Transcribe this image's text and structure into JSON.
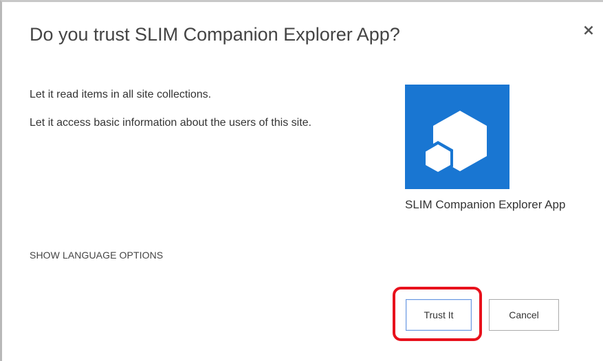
{
  "dialog": {
    "title": "Do you trust SLIM Companion Explorer App?",
    "close_icon": "close-icon"
  },
  "permissions": [
    "Let it read items in all site collections.",
    "Let it access basic information about the users of this site."
  ],
  "app": {
    "name": "SLIM Companion Explorer App",
    "logo_icon": "hexagon-cubes-icon",
    "logo_color": "#1976d2"
  },
  "language_options_label": "SHOW LANGUAGE OPTIONS",
  "buttons": {
    "trust_label": "Trust It",
    "cancel_label": "Cancel"
  },
  "annotation": {
    "highlight_color": "#e8111c"
  }
}
